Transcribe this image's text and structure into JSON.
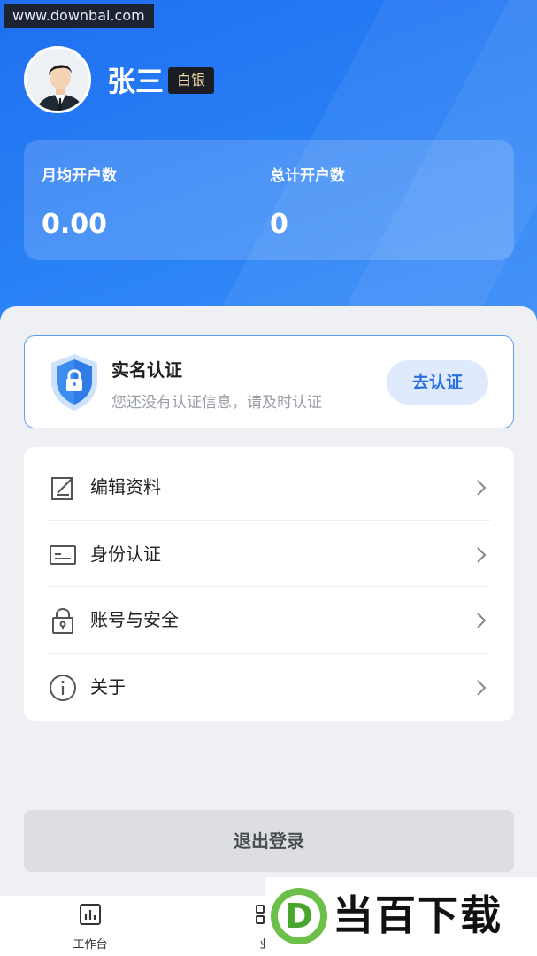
{
  "watermark": "www.downbai.com",
  "profile": {
    "name": "张三",
    "level": "白银"
  },
  "stats": {
    "monthly_label": "月均开户数",
    "monthly_value": "0.00",
    "total_label": "总计开户数",
    "total_value": "0"
  },
  "verification": {
    "title": "实名认证",
    "description": "您还没有认证信息，请及时认证",
    "button": "去认证"
  },
  "menu": {
    "items": [
      {
        "label": "编辑资料",
        "icon": "edit-icon"
      },
      {
        "label": "身份认证",
        "icon": "id-card-icon"
      },
      {
        "label": "账号与安全",
        "icon": "lock-icon"
      },
      {
        "label": "关于",
        "icon": "info-icon"
      }
    ]
  },
  "logout": "退出登录",
  "tabbar": {
    "tabs": [
      {
        "label": "工作台",
        "icon": "dashboard-icon"
      },
      {
        "label": "业",
        "icon": "business-icon"
      }
    ]
  },
  "ad": {
    "logo_letter": "D",
    "text": "当百下载"
  },
  "colors": {
    "primary": "#2b82f6",
    "accent_text": "#2a6fe0",
    "badge_bg": "#1b1d24",
    "badge_text": "#f0d9a6"
  }
}
